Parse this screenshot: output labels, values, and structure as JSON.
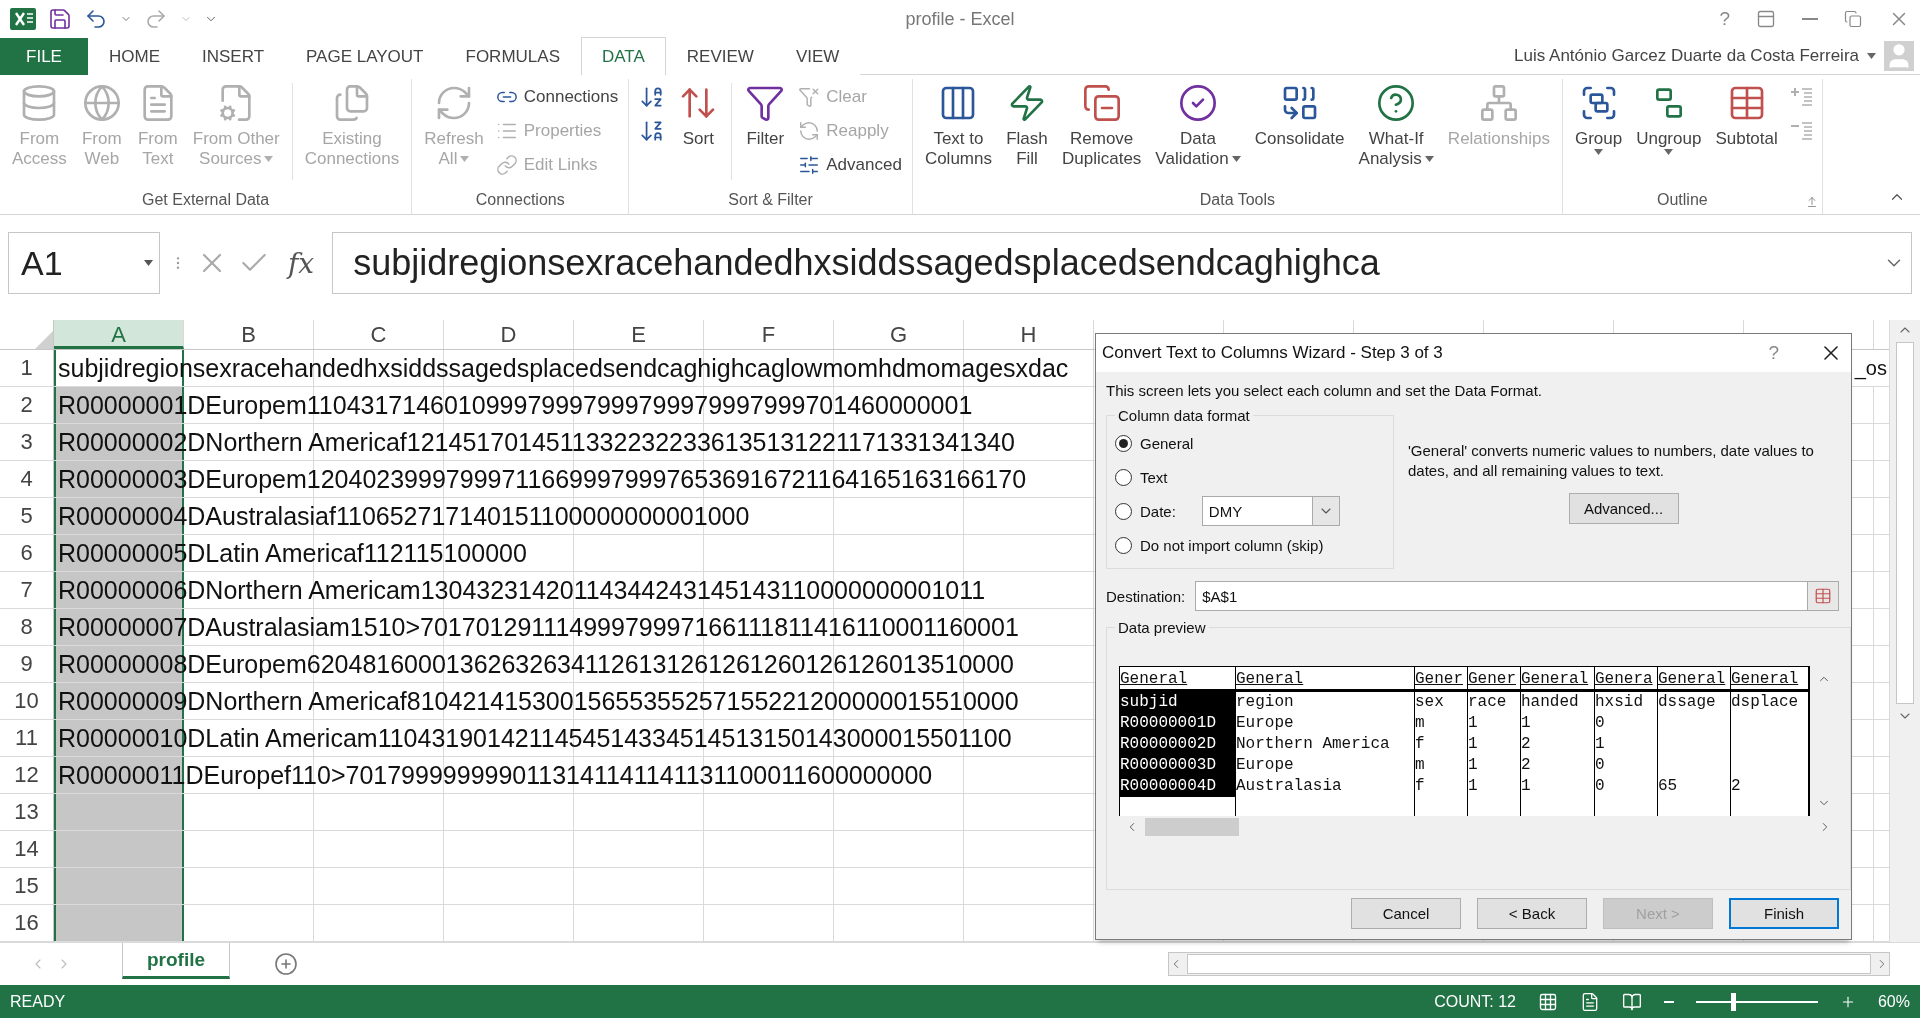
{
  "window": {
    "title": "profile - Excel",
    "help": "?"
  },
  "tabs": [
    {
      "label": "FILE",
      "kind": "file",
      "selected": false
    },
    {
      "label": "HOME",
      "kind": "tab",
      "selected": false
    },
    {
      "label": "INSERT",
      "kind": "tab",
      "selected": false
    },
    {
      "label": "PAGE LAYOUT",
      "kind": "tab",
      "selected": false
    },
    {
      "label": "FORMULAS",
      "kind": "tab",
      "selected": false
    },
    {
      "label": "DATA",
      "kind": "tab",
      "selected": true
    },
    {
      "label": "REVIEW",
      "kind": "tab",
      "selected": false
    },
    {
      "label": "VIEW",
      "kind": "tab",
      "selected": false
    }
  ],
  "user": {
    "name": "Luis António Garcez Duarte da Costa Ferreira"
  },
  "ribbon": {
    "groups": [
      {
        "label": "Get External Data",
        "launcher": false,
        "items": [
          {
            "kind": "large",
            "label": [
              "From",
              "Access"
            ],
            "disabled": true
          },
          {
            "kind": "large",
            "label": [
              "From",
              "Web"
            ],
            "disabled": true
          },
          {
            "kind": "large",
            "label": [
              "From",
              "Text"
            ],
            "disabled": true
          },
          {
            "kind": "large",
            "label": [
              "From Other",
              "Sources"
            ],
            "disabled": true,
            "dropdown": true
          },
          {
            "kind": "separator"
          },
          {
            "kind": "large",
            "label": [
              "Existing",
              "Connections"
            ],
            "disabled": true
          }
        ]
      },
      {
        "label": "Connections",
        "launcher": false,
        "items": [
          {
            "kind": "large",
            "label": [
              "Refresh",
              "All"
            ],
            "disabled": true,
            "dropdown": true
          },
          {
            "kind": "stack",
            "items": [
              {
                "label": "Connections",
                "disabled": false
              },
              {
                "label": "Properties",
                "disabled": true
              },
              {
                "label": "Edit Links",
                "disabled": true
              }
            ]
          }
        ]
      },
      {
        "label": "Sort & Filter",
        "launcher": false,
        "items": [
          {
            "kind": "stack",
            "items": [
              {
                "disabled": false
              },
              {
                "disabled": false
              }
            ]
          },
          {
            "kind": "large",
            "label": [
              "Sort"
            ],
            "disabled": false
          },
          {
            "kind": "separator"
          },
          {
            "kind": "large",
            "label": [
              "Filter"
            ],
            "disabled": false
          },
          {
            "kind": "stack",
            "items": [
              {
                "label": "Clear",
                "disabled": true
              },
              {
                "label": "Reapply",
                "disabled": true
              },
              {
                "label": "Advanced",
                "disabled": false
              }
            ]
          }
        ]
      },
      {
        "label": "Data Tools",
        "launcher": false,
        "items": [
          {
            "kind": "large",
            "label": [
              "Text to",
              "Columns"
            ],
            "disabled": false
          },
          {
            "kind": "large",
            "label": [
              "Flash",
              "Fill"
            ],
            "disabled": false
          },
          {
            "kind": "large",
            "label": [
              "Remove",
              "Duplicates"
            ],
            "disabled": false
          },
          {
            "kind": "large",
            "label": [
              "Data",
              "Validation"
            ],
            "disabled": false,
            "dropdown": true
          },
          {
            "kind": "large",
            "label": [
              "Consolidate"
            ],
            "disabled": false
          },
          {
            "kind": "large",
            "label": [
              "What-If",
              "Analysis"
            ],
            "disabled": false,
            "dropdown": true
          },
          {
            "kind": "large",
            "label": [
              "Relationships"
            ],
            "disabled": true
          }
        ]
      },
      {
        "label": "Outline",
        "launcher": true,
        "items": [
          {
            "kind": "split",
            "label": [
              "Group"
            ],
            "disabled": false
          },
          {
            "kind": "split",
            "label": [
              "Ungroup"
            ],
            "disabled": false
          },
          {
            "kind": "large",
            "label": [
              "Subtotal"
            ],
            "disabled": false
          },
          {
            "kind": "stack",
            "items": [
              {
                "disabled": true
              },
              {
                "disabled": true
              }
            ]
          }
        ]
      }
    ]
  },
  "name_box": {
    "value": "A1"
  },
  "formula_bar": {
    "function_label": "fx",
    "value": "subjidregionsexracehandedhxsiddssagedsplacedsendcaghighca"
  },
  "sheet": {
    "columns": [
      {
        "label": "A",
        "selected": true
      },
      {
        "label": "B",
        "selected": false
      },
      {
        "label": "C",
        "selected": false
      },
      {
        "label": "D",
        "selected": false
      },
      {
        "label": "E",
        "selected": false
      },
      {
        "label": "F",
        "selected": false
      },
      {
        "label": "G",
        "selected": false
      },
      {
        "label": "H",
        "selected": false
      }
    ],
    "rows": [
      {
        "number": "1",
        "active": true,
        "text": "subjidregionsexracehandedhxsiddssagedsplacedsendcaghighcaglowmomhdmomagesxdac",
        "tail": "_os"
      },
      {
        "number": "2",
        "active": false,
        "text": "R00000001DEuropem110431714601099979997999799979997999701460000001"
      },
      {
        "number": "3",
        "active": false,
        "text": "R00000002DNorthern Americaf12145170145113322322336135131221171331341340"
      },
      {
        "number": "4",
        "active": false,
        "text": "R00000003DEuropem1204023999799971166999799976536916721164165163166170"
      },
      {
        "number": "5",
        "active": false,
        "text": "R00000004DAustralasiaf110652717140151100000000001000"
      },
      {
        "number": "6",
        "active": false,
        "text": "R00000005DLatin Americaf112115100000"
      },
      {
        "number": "7",
        "active": false,
        "text": "R00000006DNorthern Americam13043231420114344243145143110000000001011"
      },
      {
        "number": "8",
        "active": false,
        "text": "R00000007DAustralasiam1510>70170129111499979997166111811416110001160001"
      },
      {
        "number": "9",
        "active": false,
        "text": "R00000008DEuropem620481600013626326341126131261261260126126013510000"
      },
      {
        "number": "10",
        "active": false,
        "text": "R00000009DNorthern Americaf81042141530015655355257155221200000015510000"
      },
      {
        "number": "11",
        "active": false,
        "text": "R00000010DLatin Americam1104319014211454514334514513150143000015501100"
      },
      {
        "number": "12",
        "active": false,
        "text": "R00000011DEuropef110>7017999999990113141141141131100011600000000"
      },
      {
        "number": "13",
        "active": false
      },
      {
        "number": "14",
        "active": false
      },
      {
        "number": "15",
        "active": false
      },
      {
        "number": "16",
        "active": false
      }
    ]
  },
  "sheet_tabs": [
    {
      "label": "profile",
      "selected": true
    }
  ],
  "status_bar": {
    "mode": "READY",
    "count": "COUNT: 12",
    "zoom": "60%",
    "zoom_level": {
      "level": 0.3
    }
  },
  "dialog": {
    "title": "Convert Text to Columns Wizard - Step 3 of 3",
    "help": "?",
    "intro": "This screen lets you select each column and set the Data Format.",
    "format_group": {
      "label": "Column data format",
      "options": [
        {
          "kind": "radio",
          "label": "General",
          "selected": true
        },
        {
          "kind": "radio",
          "label": "Text",
          "selected": false
        },
        {
          "kind": "date",
          "label": "Date:",
          "selected": false,
          "value": "DMY"
        },
        {
          "kind": "radio",
          "label": "Do not import column (skip)",
          "selected": false
        }
      ]
    },
    "description": "'General' converts numeric values to numbers, date values to dates, and all remaining values to text.",
    "advanced_button": "Advanced...",
    "destination": {
      "label": "Destination:",
      "value": "$A$1"
    },
    "preview": {
      "label": "Data preview",
      "columns": [
        {
          "format": "General",
          "selected": true,
          "cells": [
            {
              "text": "subjid"
            },
            {
              "text": "R00000001D"
            },
            {
              "text": "R00000002D"
            },
            {
              "text": "R00000003D"
            },
            {
              "text": "R00000004D"
            }
          ]
        },
        {
          "format": "General",
          "selected": false,
          "cells": [
            {
              "text": "region"
            },
            {
              "text": "Europe"
            },
            {
              "text": "Northern America"
            },
            {
              "text": "Europe"
            },
            {
              "text": "Australasia"
            }
          ]
        },
        {
          "format": "Gener",
          "selected": false,
          "cells": [
            {
              "text": "sex"
            },
            {
              "text": "m"
            },
            {
              "text": "f"
            },
            {
              "text": "m"
            },
            {
              "text": "f"
            }
          ]
        },
        {
          "format": "Gener",
          "selected": false,
          "cells": [
            {
              "text": "race"
            },
            {
              "text": "1"
            },
            {
              "text": "1"
            },
            {
              "text": "1"
            },
            {
              "text": "1"
            }
          ]
        },
        {
          "format": "General",
          "selected": false,
          "cells": [
            {
              "text": "handed"
            },
            {
              "text": "1"
            },
            {
              "text": "2"
            },
            {
              "text": "2"
            },
            {
              "text": "1"
            }
          ]
        },
        {
          "format": "Genera",
          "selected": false,
          "cells": [
            {
              "text": "hxsid"
            },
            {
              "text": "0"
            },
            {
              "text": "1"
            },
            {
              "text": "0"
            },
            {
              "text": "0"
            }
          ]
        },
        {
          "format": "General",
          "selected": false,
          "cells": [
            {
              "text": "dssage"
            },
            {},
            {},
            {},
            {
              "text": "65"
            }
          ]
        },
        {
          "format": "General",
          "selected": false,
          "cells": [
            {
              "text": "dsplace"
            },
            {},
            {},
            {},
            {
              "text": "2"
            }
          ]
        }
      ]
    },
    "buttons": [
      {
        "label": "Cancel",
        "disabled": false,
        "default": false
      },
      {
        "label": "< Back",
        "disabled": false,
        "default": false
      },
      {
        "label": "Next >",
        "disabled": true,
        "default": false
      },
      {
        "label": "Finish",
        "disabled": false,
        "default": true
      }
    ]
  }
}
